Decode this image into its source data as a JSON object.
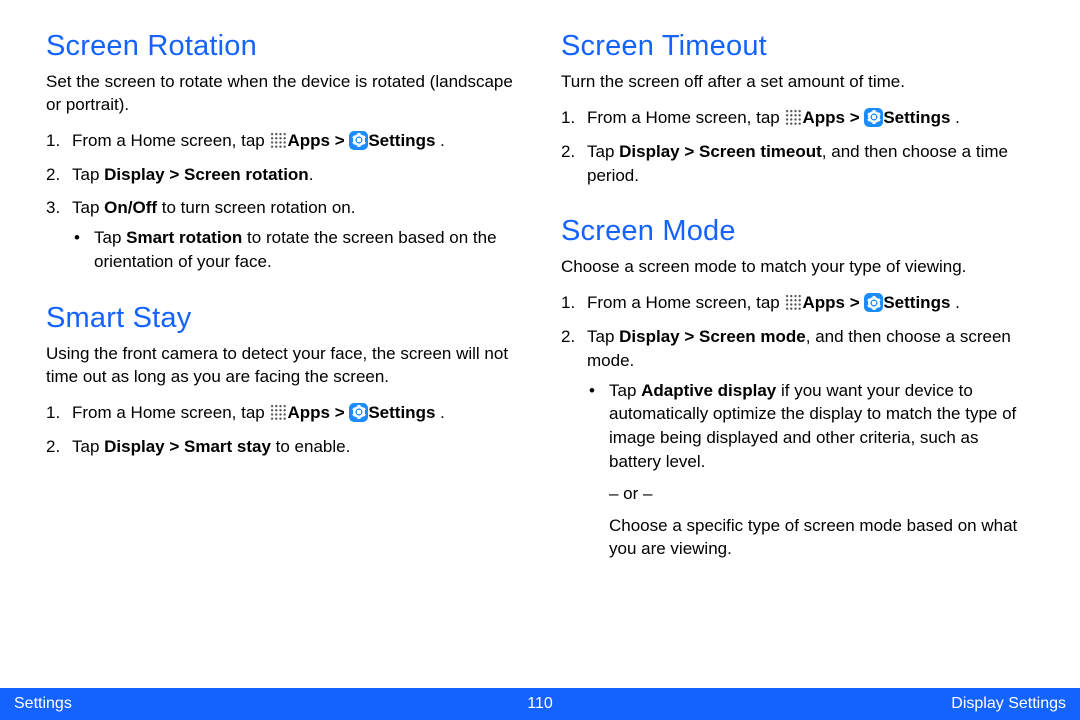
{
  "footer": {
    "left": "Settings",
    "page": "110",
    "right": "Display Settings"
  },
  "common": {
    "from_home_prefix": "From a Home screen, tap ",
    "apps_label": "Apps > ",
    "settings_label": "Settings",
    "period": " ."
  },
  "left_col": {
    "rotation": {
      "title": "Screen Rotation",
      "intro": "Set the screen to rotate when the device is rotated (landscape or portrait).",
      "step2_a": "Tap ",
      "step2_b": "Display > Screen rotation",
      "step2_c": ".",
      "step3_a": "Tap ",
      "step3_b": "On/Off",
      "step3_c": " to turn screen rotation on.",
      "bullet_a": "Tap ",
      "bullet_b": "Smart rotation",
      "bullet_c": " to rotate the screen based on the orientation of your face."
    },
    "smartstay": {
      "title": "Smart Stay",
      "intro": "Using the front camera to detect your face, the screen will not time out as long as you are facing the screen.",
      "step2_a": "Tap ",
      "step2_b": "Display > Smart stay",
      "step2_c": " to enable."
    }
  },
  "right_col": {
    "timeout": {
      "title": "Screen Timeout",
      "intro": "Turn the screen off after a set amount of time.",
      "step2_a": "Tap ",
      "step2_b": "Display > Screen timeout",
      "step2_c": ", and then choose a time period."
    },
    "mode": {
      "title": "Screen Mode",
      "intro": "Choose a screen mode to match your type of viewing.",
      "step2_a": "Tap ",
      "step2_b": "Display > Screen mode",
      "step2_c": ", and then choose a screen mode.",
      "bullet_a": "Tap ",
      "bullet_b": "Adaptive display",
      "bullet_c": " if you want your device to automatically optimize the display to match the type of image being displayed and other criteria, such as battery level.",
      "or": "– or –",
      "subtext": "Choose a specific type of screen mode based on what you are viewing."
    }
  }
}
